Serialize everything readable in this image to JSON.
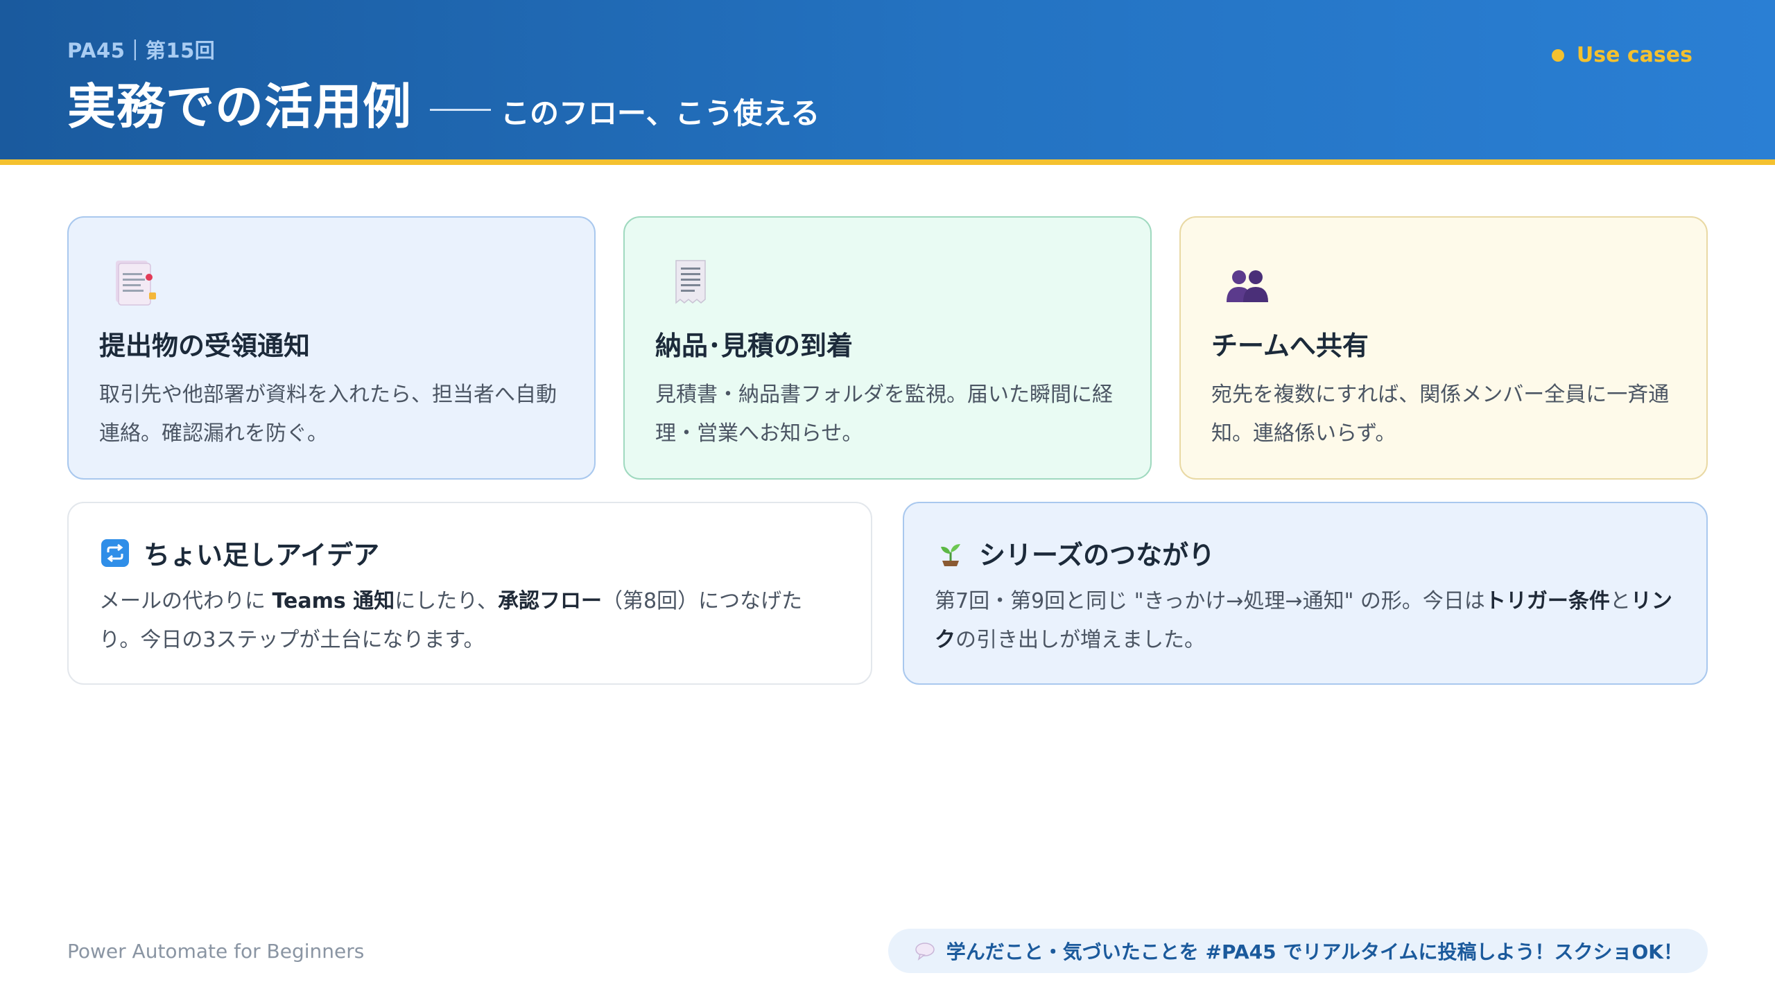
{
  "header": {
    "eyebrow": "PA45｜第15回",
    "title": "実務での活用例",
    "subtitle": "このフロー、こう使える",
    "tag": "Use cases"
  },
  "cards": [
    {
      "icon": "document-clip-icon",
      "title": "提出物の受領通知",
      "body": "取引先や他部署が資料を入れたら、担当者へ自動連絡。確認漏れを防ぐ。"
    },
    {
      "icon": "receipt-icon",
      "title": "納品･見積の到着",
      "body": "見積書・納品書フォルダを監視。届いた瞬間に経理・営業へお知らせ。"
    },
    {
      "icon": "people-icon",
      "title": "チームへ共有",
      "body": "宛先を複数にすれば、関係メンバー全員に一斉通知。連絡係いらず。"
    }
  ],
  "ideas": {
    "icon": "repeat-icon",
    "title": "ちょい足しアイデア",
    "t1": "メールの代わりに ",
    "b1": "Teams 通知",
    "t2": "にしたり、",
    "b2": "承認フロー",
    "t3": "（第8回）につなげたり。今日の3ステップが土台になります。"
  },
  "series": {
    "icon": "sprout-icon",
    "title": "シリーズのつながり",
    "t1": "第7回・第9回と同じ \"きっかけ→処理→通知\" の形。今日は",
    "b1": "トリガー条件",
    "t2": "と",
    "b2": "リンク",
    "t3": "の引き出しが増えました。"
  },
  "footer": {
    "brand": "Power Automate for Beginners",
    "cta_icon": "speech-bubble-icon",
    "cta": "学んだこと・気づいたことを #PA45 でリアルタイムに投稿しよう！スクショOK！"
  },
  "colors": {
    "header_start": "#1a5a9e",
    "header_end": "#2a7fd4",
    "accent": "#f4c12f"
  }
}
